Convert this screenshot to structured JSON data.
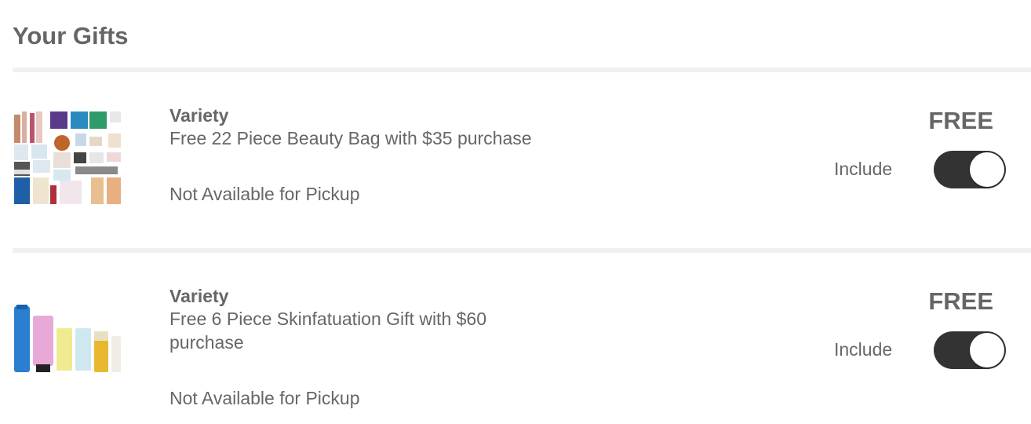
{
  "page": {
    "title": "Your Gifts"
  },
  "gifts": [
    {
      "brand": "Variety",
      "name": "Free 22 Piece Beauty Bag with $35 purchase",
      "pickup": "Not Available for Pickup",
      "price": "FREE",
      "toggle_label": "Include",
      "included": true
    },
    {
      "brand": "Variety",
      "name": "Free 6 Piece Skinfatuation Gift with $60 purchase",
      "pickup": "Not Available for Pickup",
      "price": "FREE",
      "toggle_label": "Include",
      "included": true
    }
  ],
  "colors": {
    "text": "#666666",
    "toggle_on": "#333333",
    "divider": "#f0f0f0"
  }
}
